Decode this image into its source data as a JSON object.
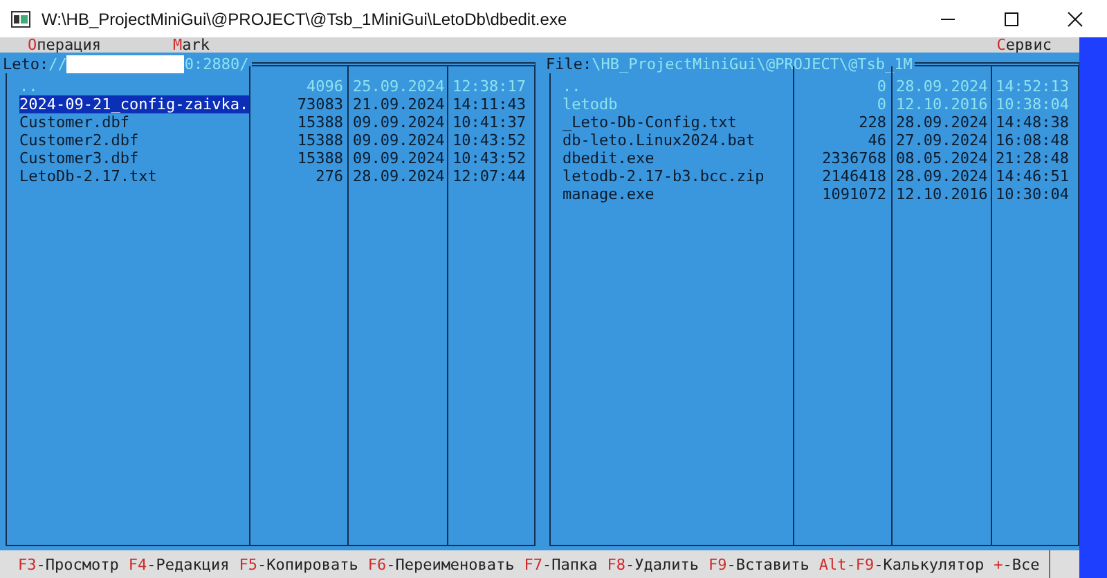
{
  "window": {
    "title": "W:\\HB_ProjectMiniGui\\@PROJECT\\@Tsb_1MiniGui\\LetoDb\\dbedit.exe"
  },
  "menu": [
    {
      "hot": "О",
      "rest": "перация"
    },
    {
      "hot": "M",
      "rest": "ark"
    }
  ],
  "menu_right": [
    {
      "hot": "С",
      "rest": "ервис"
    }
  ],
  "panels": [
    {
      "label": "Leto:",
      "path_before": "//",
      "redacted": true,
      "path_after": "0:2880/",
      "rows": [
        {
          "name": "..",
          "size": "4096",
          "date": "25.09.2024",
          "time": "12:38:17",
          "kind": "parent",
          "selected": false
        },
        {
          "name": "2024-09-21_config-zaivka.",
          "size": "73083",
          "date": "21.09.2024",
          "time": "14:11:43",
          "kind": "file",
          "selected": true
        },
        {
          "name": "Customer.dbf",
          "size": "15388",
          "date": "09.09.2024",
          "time": "10:41:37",
          "kind": "file",
          "selected": false
        },
        {
          "name": "Customer2.dbf",
          "size": "15388",
          "date": "09.09.2024",
          "time": "10:43:52",
          "kind": "file",
          "selected": false
        },
        {
          "name": "Customer3.dbf",
          "size": "15388",
          "date": "09.09.2024",
          "time": "10:43:52",
          "kind": "file",
          "selected": false
        },
        {
          "name": "LetoDb-2.17.txt",
          "size": "276",
          "date": "28.09.2024",
          "time": "12:07:44",
          "kind": "file",
          "selected": false
        }
      ]
    },
    {
      "label": "File:",
      "path_before": "\\HB_ProjectMiniGui\\@PROJECT\\@Tsb_1M",
      "redacted": false,
      "rows": [
        {
          "name": "..",
          "size": "0",
          "date": "28.09.2024",
          "time": "14:52:13",
          "kind": "parent",
          "selected": false
        },
        {
          "name": "letodb",
          "size": "0",
          "date": "12.10.2016",
          "time": "10:38:04",
          "kind": "dir",
          "selected": false
        },
        {
          "name": "_Leto-Db-Config.txt",
          "size": "228",
          "date": "28.09.2024",
          "time": "14:48:38",
          "kind": "file",
          "selected": false
        },
        {
          "name": "db-leto.Linux2024.bat",
          "size": "46",
          "date": "27.09.2024",
          "time": "16:08:48",
          "kind": "file",
          "selected": false
        },
        {
          "name": "dbedit.exe",
          "size": "2336768",
          "date": "08.05.2024",
          "time": "21:28:48",
          "kind": "file",
          "selected": false
        },
        {
          "name": "letodb-2.17-b3.bcc.zip",
          "size": "2146418",
          "date": "28.09.2024",
          "time": "14:46:51",
          "kind": "file",
          "selected": false
        },
        {
          "name": "manage.exe",
          "size": "1091072",
          "date": "12.10.2016",
          "time": "10:30:04",
          "kind": "file",
          "selected": false
        }
      ]
    }
  ],
  "function_keys": [
    {
      "key": "F3",
      "label": "-Просмотр"
    },
    {
      "key": "F4",
      "label": "-Редакция"
    },
    {
      "key": "F5",
      "label": "-Копировать"
    },
    {
      "key": "F6",
      "label": "-Переименовать"
    },
    {
      "key": "F7",
      "label": "-Папка"
    },
    {
      "key": "F8",
      "label": "-Удалить"
    },
    {
      "key": "F9",
      "label": "-Вставить"
    },
    {
      "key": "Alt-F9",
      "label": "-Калькулятор"
    },
    {
      "key": "+",
      "label": "-Все"
    }
  ]
}
